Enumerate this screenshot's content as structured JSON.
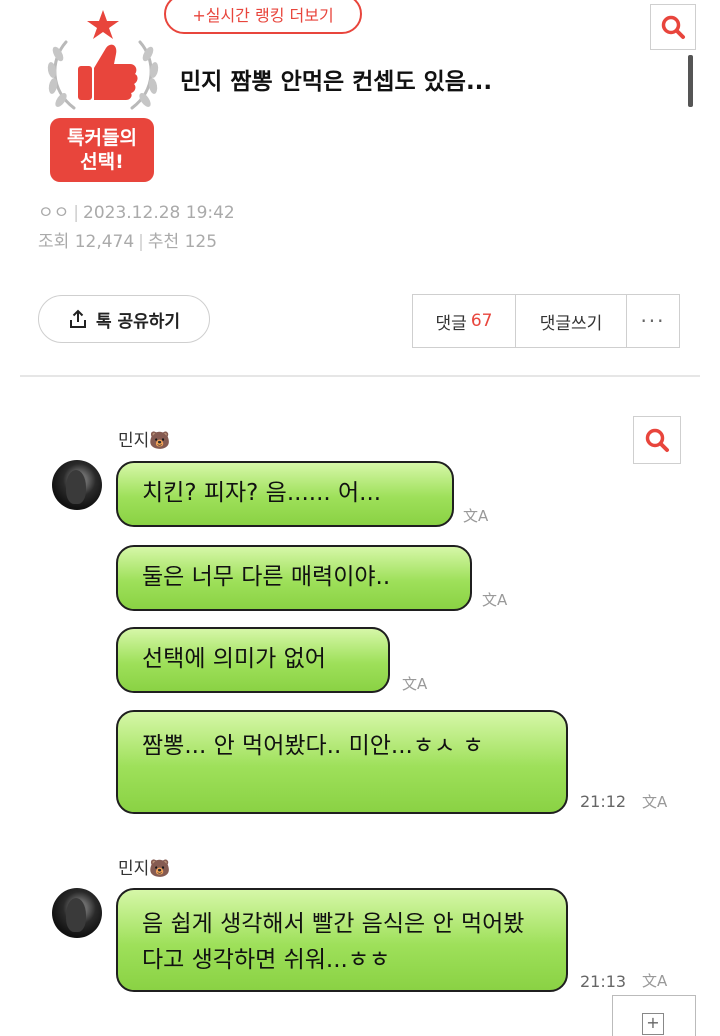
{
  "header": {
    "ranking_link": "+실시간 랭킹 더보기",
    "badge_line1": "톡커들의",
    "badge_line2": "선택!",
    "post_title": "민지 짬뽕 안먹은 컨셉도 있음...",
    "author": "ㅇㅇ",
    "date": "2023.12.28 19:42",
    "views_label": "조회",
    "views": "12,474",
    "recommend_label": "추천",
    "recommend": "125"
  },
  "actions": {
    "share_label": "톡 공유하기",
    "comments_label": "댓글",
    "comments_count": "67",
    "write_comment_label": "댓글쓰기",
    "more_label": "···"
  },
  "chat": {
    "sender_1": "민지🐻",
    "sender_2": "민지🐻",
    "messages": [
      "치킨? 피자? 음...... 어...",
      "둘은 너무 다른 매력이야..",
      "선택에 의미가 없어",
      "짬뽕... 안 먹어봤다.. 미안...ㅎㅅ ㅎ",
      "음 쉽게 생각해서 빨간 음식은 안 먹어봤다고 생각하면 쉬워...ㅎㅎ"
    ],
    "time_1": "21:12",
    "time_2": "21:13",
    "translate_glyph": "文A"
  },
  "colors": {
    "accent": "#e8453c",
    "bubble_green": "#9ee05a",
    "meta_gray": "#aaaaaa"
  },
  "icons": [
    "search-icon",
    "share-icon",
    "thumbs-up-icon",
    "star-icon",
    "translate-icon",
    "plus-icon"
  ]
}
